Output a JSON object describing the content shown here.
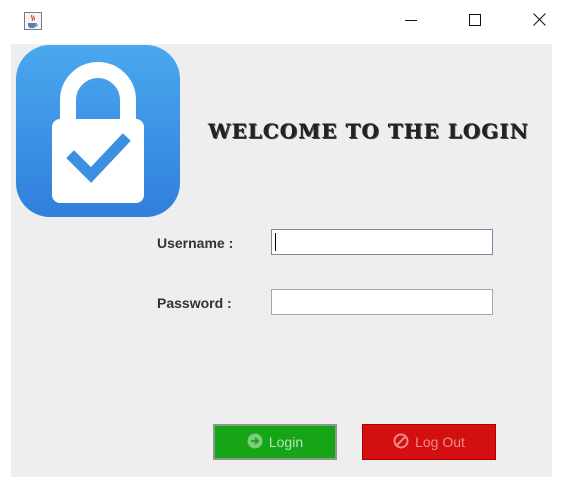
{
  "window": {
    "app_icon": "java-coffee-cup-icon",
    "minimize_icon": "minimize-icon",
    "maximize_icon": "maximize-icon",
    "close_icon": "close-icon"
  },
  "logo": {
    "icon": "padlock-checkmark-icon",
    "colors": {
      "top": "#4aa8ee",
      "bottom": "#2f7fdc",
      "lock": "#ffffff",
      "check": "#3d8fe0"
    }
  },
  "header": {
    "welcome_text": "WELCOME TO THE LOGIN"
  },
  "form": {
    "username_label": "Username :",
    "username_value": "",
    "password_label": "Password :",
    "password_value": ""
  },
  "buttons": {
    "login_label": "Login",
    "login_icon": "circle-arrow-right-icon",
    "login_color": "#16a516",
    "logout_label": "Log Out",
    "logout_icon": "prohibited-icon",
    "logout_color": "#d40f0f"
  }
}
